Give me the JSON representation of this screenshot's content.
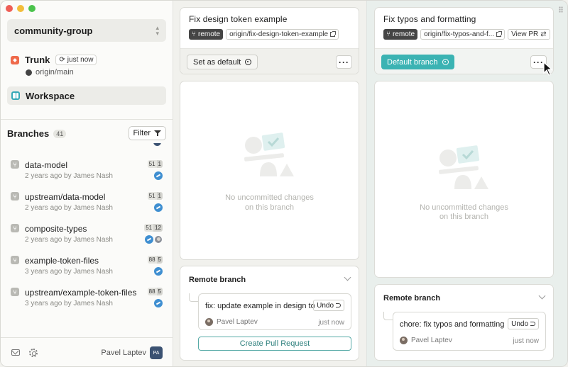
{
  "sidebar": {
    "project": "community-group",
    "trunk": {
      "title": "Trunk",
      "badge": "just now",
      "remote": "origin/main"
    },
    "workspace": "Workspace",
    "branches": {
      "title": "Branches",
      "count": "41",
      "filter_label": "Filter",
      "items": [
        {
          "name": "data-model",
          "meta": "2 years ago by James Nash",
          "ahead": "51",
          "behind": "1"
        },
        {
          "name": "upstream/data-model",
          "meta": "2 years ago by James Nash",
          "ahead": "51",
          "behind": "1"
        },
        {
          "name": "composite-types",
          "meta": "2 years ago by James Nash",
          "ahead": "51",
          "behind": "12"
        },
        {
          "name": "example-token-files",
          "meta": "3 years ago by James Nash",
          "ahead": "88",
          "behind": "5"
        },
        {
          "name": "upstream/example-token-files",
          "meta": "3 years ago by James Nash",
          "ahead": "88",
          "behind": "5"
        }
      ]
    },
    "footer": {
      "user_name": "Pavel Laptev",
      "user_initials": "PA"
    }
  },
  "lanes": [
    {
      "title": "Fix design token example",
      "remote_tag": "remote",
      "origin_tag": "origin/fix-design-token-example",
      "action_label": "Set as default",
      "empty_line1": "No uncommitted changes",
      "empty_line2": "on this branch",
      "remote_section_title": "Remote branch",
      "commit": {
        "message": "fix: update example in design to...",
        "undo_label": "Undo",
        "author": "Pavel Laptev",
        "time": "just now"
      },
      "pr_label": "Create Pull Request"
    },
    {
      "title": "Fix typos and formatting",
      "remote_tag": "remote",
      "origin_tag": "origin/fix-typos-and-f...",
      "view_pr_label": "View PR",
      "action_label": "Default branch",
      "empty_line1": "No uncommitted changes",
      "empty_line2": "on this branch",
      "remote_section_title": "Remote branch",
      "commit": {
        "message": "chore: fix typos and formatting ...",
        "undo_label": "Undo",
        "author": "Pavel Laptev",
        "time": "just now"
      }
    }
  ],
  "colors": {
    "accent_teal": "#3bb3b3",
    "trunk_orange": "#ef6a4b",
    "workspace_teal": "#36a9b7"
  }
}
